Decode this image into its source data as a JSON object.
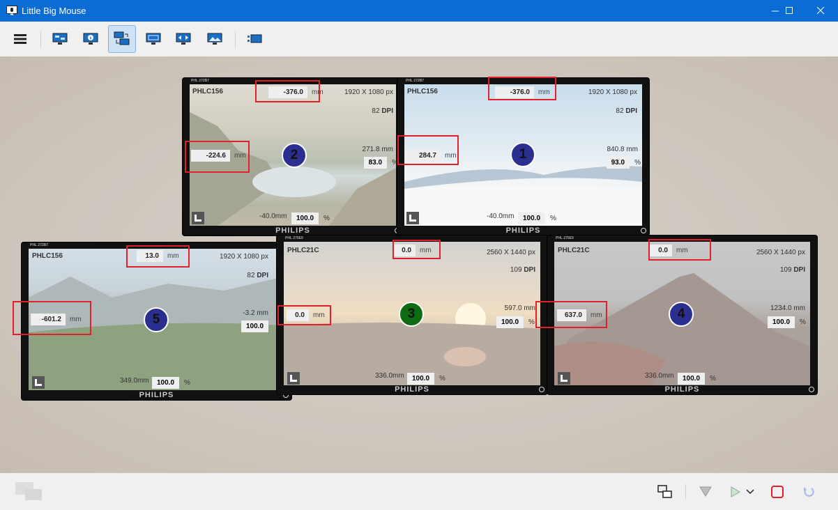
{
  "window": {
    "title": "Little Big Mouse"
  },
  "colors": {
    "titlebar": "#0b6cd3",
    "badge_blue": "#2b2f8f",
    "badge_green": "#0d6b12",
    "highlight_red": "#e0202a"
  },
  "toolbar": {
    "icons": [
      "menu-icon",
      "location-view-icon",
      "info-view-icon",
      "layout-view-icon",
      "size-view-icon",
      "border-view-icon",
      "wallpaper-view-icon",
      "list-view-icon"
    ],
    "active": "layout-view-icon"
  },
  "monitors": [
    {
      "id": "m2",
      "number": "2",
      "model": "PHLC156",
      "tag": "PHL 272B7",
      "resolution": "1920 X 1080 px",
      "dpi": "82",
      "dpi_unit": "DPI",
      "top_value": "-376.0",
      "left_value": "-224.6",
      "right_mm": "271.8 mm",
      "right_pct": "83.0",
      "bottom_mm": "-40.0mm",
      "bottom_pct": "100.0",
      "unit": "mm",
      "pct_unit": "%",
      "brand": "PHILIPS",
      "badge": "blue"
    },
    {
      "id": "m1",
      "number": "1",
      "model": "PHLC156",
      "tag": "PHL 272B7",
      "resolution": "1920 X 1080 px",
      "dpi": "82",
      "dpi_unit": "DPI",
      "top_value": "-376.0",
      "left_value": "284.7",
      "right_mm": "840.8 mm",
      "right_pct": "93.0",
      "bottom_mm": "-40.0mm",
      "bottom_pct": "100.0",
      "unit": "mm",
      "pct_unit": "%",
      "brand": "PHILIPS",
      "badge": "blue"
    },
    {
      "id": "m5",
      "number": "5",
      "model": "PHLC156",
      "tag": "PHL 272B7",
      "resolution": "1920 X 1080 px",
      "dpi": "82",
      "dpi_unit": "DPI",
      "top_value": "13.0",
      "left_value": "-601.2",
      "right_mm": "-3.2 mm",
      "right_pct": "100.0",
      "bottom_mm": "349.0mm",
      "bottom_pct": "100.0",
      "unit": "mm",
      "pct_unit": "%",
      "brand": "PHILIPS",
      "badge": "blue"
    },
    {
      "id": "m3",
      "number": "3",
      "model": "PHLC21C",
      "tag": "PHL 275E9",
      "resolution": "2560 X 1440 px",
      "dpi": "109",
      "dpi_unit": "DPI",
      "top_value": "0.0",
      "left_value": "0.0",
      "right_mm": "597.0 mm",
      "right_pct": "100.0",
      "bottom_mm": "336.0mm",
      "bottom_pct": "100.0",
      "unit": "mm",
      "pct_unit": "%",
      "brand": "PHILIPS",
      "badge": "green"
    },
    {
      "id": "m4",
      "number": "4",
      "model": "PHLC21C",
      "tag": "PHL 275E9",
      "resolution": "2560 X 1440 px",
      "dpi": "109",
      "dpi_unit": "DPI",
      "top_value": "0.0",
      "left_value": "637.0",
      "right_mm": "1234.0 mm",
      "right_pct": "100.0",
      "bottom_mm": "336.0mm",
      "bottom_pct": "100.0",
      "unit": "mm",
      "pct_unit": "%",
      "brand": "PHILIPS",
      "badge": "blue"
    }
  ],
  "bottombar": {
    "icons": [
      "copy-layout-icon",
      "filter-icon",
      "start-icon",
      "dropdown-chevron-icon",
      "stop-icon",
      "undo-icon"
    ]
  }
}
